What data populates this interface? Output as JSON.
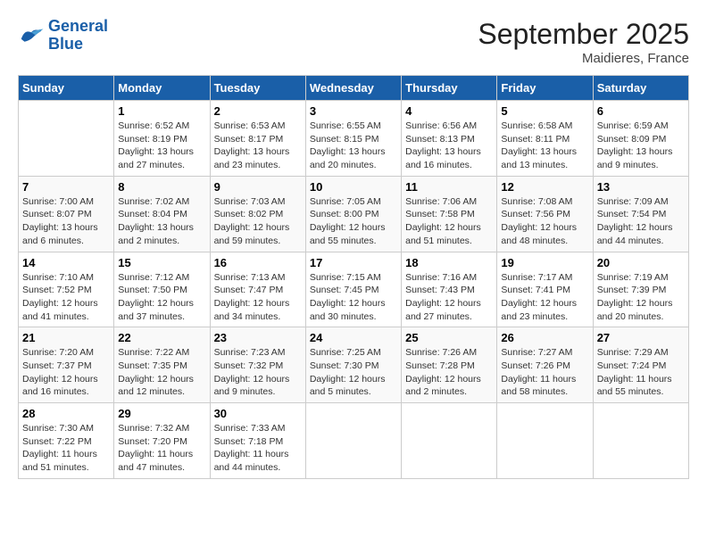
{
  "logo": {
    "line1": "General",
    "line2": "Blue"
  },
  "title": "September 2025",
  "location": "Maidieres, France",
  "days_header": [
    "Sunday",
    "Monday",
    "Tuesday",
    "Wednesday",
    "Thursday",
    "Friday",
    "Saturday"
  ],
  "weeks": [
    [
      {
        "day": "",
        "info": ""
      },
      {
        "day": "1",
        "info": "Sunrise: 6:52 AM\nSunset: 8:19 PM\nDaylight: 13 hours\nand 27 minutes."
      },
      {
        "day": "2",
        "info": "Sunrise: 6:53 AM\nSunset: 8:17 PM\nDaylight: 13 hours\nand 23 minutes."
      },
      {
        "day": "3",
        "info": "Sunrise: 6:55 AM\nSunset: 8:15 PM\nDaylight: 13 hours\nand 20 minutes."
      },
      {
        "day": "4",
        "info": "Sunrise: 6:56 AM\nSunset: 8:13 PM\nDaylight: 13 hours\nand 16 minutes."
      },
      {
        "day": "5",
        "info": "Sunrise: 6:58 AM\nSunset: 8:11 PM\nDaylight: 13 hours\nand 13 minutes."
      },
      {
        "day": "6",
        "info": "Sunrise: 6:59 AM\nSunset: 8:09 PM\nDaylight: 13 hours\nand 9 minutes."
      }
    ],
    [
      {
        "day": "7",
        "info": "Sunrise: 7:00 AM\nSunset: 8:07 PM\nDaylight: 13 hours\nand 6 minutes."
      },
      {
        "day": "8",
        "info": "Sunrise: 7:02 AM\nSunset: 8:04 PM\nDaylight: 13 hours\nand 2 minutes."
      },
      {
        "day": "9",
        "info": "Sunrise: 7:03 AM\nSunset: 8:02 PM\nDaylight: 12 hours\nand 59 minutes."
      },
      {
        "day": "10",
        "info": "Sunrise: 7:05 AM\nSunset: 8:00 PM\nDaylight: 12 hours\nand 55 minutes."
      },
      {
        "day": "11",
        "info": "Sunrise: 7:06 AM\nSunset: 7:58 PM\nDaylight: 12 hours\nand 51 minutes."
      },
      {
        "day": "12",
        "info": "Sunrise: 7:08 AM\nSunset: 7:56 PM\nDaylight: 12 hours\nand 48 minutes."
      },
      {
        "day": "13",
        "info": "Sunrise: 7:09 AM\nSunset: 7:54 PM\nDaylight: 12 hours\nand 44 minutes."
      }
    ],
    [
      {
        "day": "14",
        "info": "Sunrise: 7:10 AM\nSunset: 7:52 PM\nDaylight: 12 hours\nand 41 minutes."
      },
      {
        "day": "15",
        "info": "Sunrise: 7:12 AM\nSunset: 7:50 PM\nDaylight: 12 hours\nand 37 minutes."
      },
      {
        "day": "16",
        "info": "Sunrise: 7:13 AM\nSunset: 7:47 PM\nDaylight: 12 hours\nand 34 minutes."
      },
      {
        "day": "17",
        "info": "Sunrise: 7:15 AM\nSunset: 7:45 PM\nDaylight: 12 hours\nand 30 minutes."
      },
      {
        "day": "18",
        "info": "Sunrise: 7:16 AM\nSunset: 7:43 PM\nDaylight: 12 hours\nand 27 minutes."
      },
      {
        "day": "19",
        "info": "Sunrise: 7:17 AM\nSunset: 7:41 PM\nDaylight: 12 hours\nand 23 minutes."
      },
      {
        "day": "20",
        "info": "Sunrise: 7:19 AM\nSunset: 7:39 PM\nDaylight: 12 hours\nand 20 minutes."
      }
    ],
    [
      {
        "day": "21",
        "info": "Sunrise: 7:20 AM\nSunset: 7:37 PM\nDaylight: 12 hours\nand 16 minutes."
      },
      {
        "day": "22",
        "info": "Sunrise: 7:22 AM\nSunset: 7:35 PM\nDaylight: 12 hours\nand 12 minutes."
      },
      {
        "day": "23",
        "info": "Sunrise: 7:23 AM\nSunset: 7:32 PM\nDaylight: 12 hours\nand 9 minutes."
      },
      {
        "day": "24",
        "info": "Sunrise: 7:25 AM\nSunset: 7:30 PM\nDaylight: 12 hours\nand 5 minutes."
      },
      {
        "day": "25",
        "info": "Sunrise: 7:26 AM\nSunset: 7:28 PM\nDaylight: 12 hours\nand 2 minutes."
      },
      {
        "day": "26",
        "info": "Sunrise: 7:27 AM\nSunset: 7:26 PM\nDaylight: 11 hours\nand 58 minutes."
      },
      {
        "day": "27",
        "info": "Sunrise: 7:29 AM\nSunset: 7:24 PM\nDaylight: 11 hours\nand 55 minutes."
      }
    ],
    [
      {
        "day": "28",
        "info": "Sunrise: 7:30 AM\nSunset: 7:22 PM\nDaylight: 11 hours\nand 51 minutes."
      },
      {
        "day": "29",
        "info": "Sunrise: 7:32 AM\nSunset: 7:20 PM\nDaylight: 11 hours\nand 47 minutes."
      },
      {
        "day": "30",
        "info": "Sunrise: 7:33 AM\nSunset: 7:18 PM\nDaylight: 11 hours\nand 44 minutes."
      },
      {
        "day": "",
        "info": ""
      },
      {
        "day": "",
        "info": ""
      },
      {
        "day": "",
        "info": ""
      },
      {
        "day": "",
        "info": ""
      }
    ]
  ]
}
